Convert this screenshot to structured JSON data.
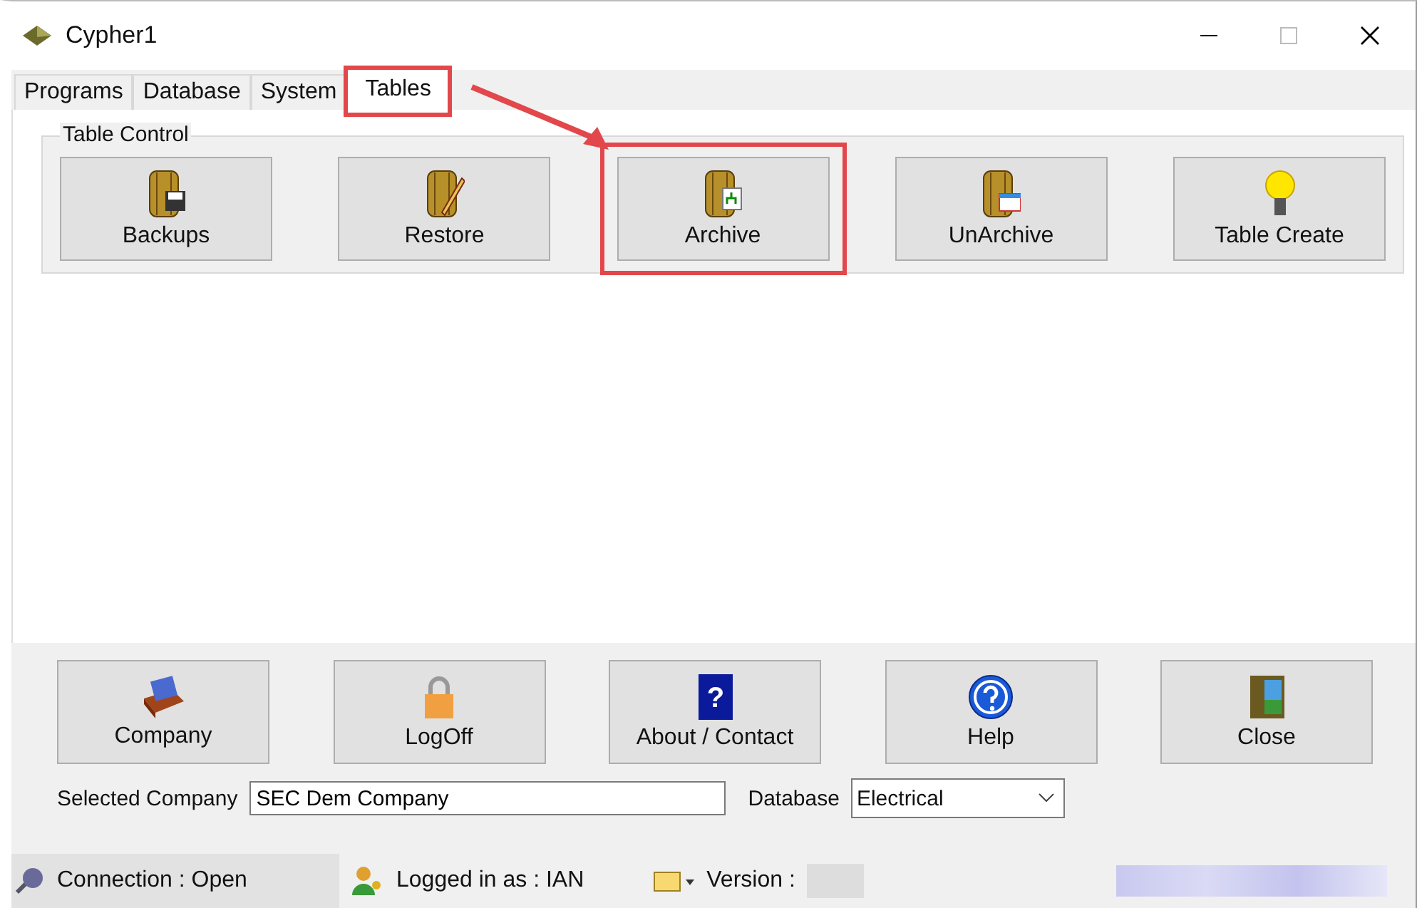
{
  "window": {
    "title": "Cypher1"
  },
  "tabs": [
    {
      "label": "Programs",
      "selected": false,
      "highlighted": false
    },
    {
      "label": "Database",
      "selected": false,
      "highlighted": false
    },
    {
      "label": "System",
      "selected": false,
      "highlighted": false
    },
    {
      "label": "Tables",
      "selected": true,
      "highlighted": true
    }
  ],
  "table_control": {
    "title": "Table Control",
    "buttons": [
      {
        "label": "Backups",
        "kind": "backup",
        "highlighted": false
      },
      {
        "label": "Restore",
        "kind": "restore",
        "highlighted": false
      },
      {
        "label": "Archive",
        "kind": "archive",
        "highlighted": true
      },
      {
        "label": "UnArchive",
        "kind": "unarchive",
        "highlighted": false
      },
      {
        "label": "Table Create",
        "kind": "bulb",
        "highlighted": false
      }
    ]
  },
  "bottom_buttons": [
    {
      "label": "Company",
      "kind": "company"
    },
    {
      "label": "LogOff",
      "kind": "lock"
    },
    {
      "label": "About / Contact",
      "kind": "question",
      "glyph": "?"
    },
    {
      "label": "Help",
      "kind": "help"
    },
    {
      "label": "Close",
      "kind": "door"
    }
  ],
  "selected_company": {
    "label": "Selected Company",
    "value": "SEC Dem Company"
  },
  "database": {
    "label": "Database",
    "value": "Electrical"
  },
  "status_bar": {
    "connection": "Connection : Open",
    "user": "Logged in as : IAN",
    "version": "Version :"
  }
}
